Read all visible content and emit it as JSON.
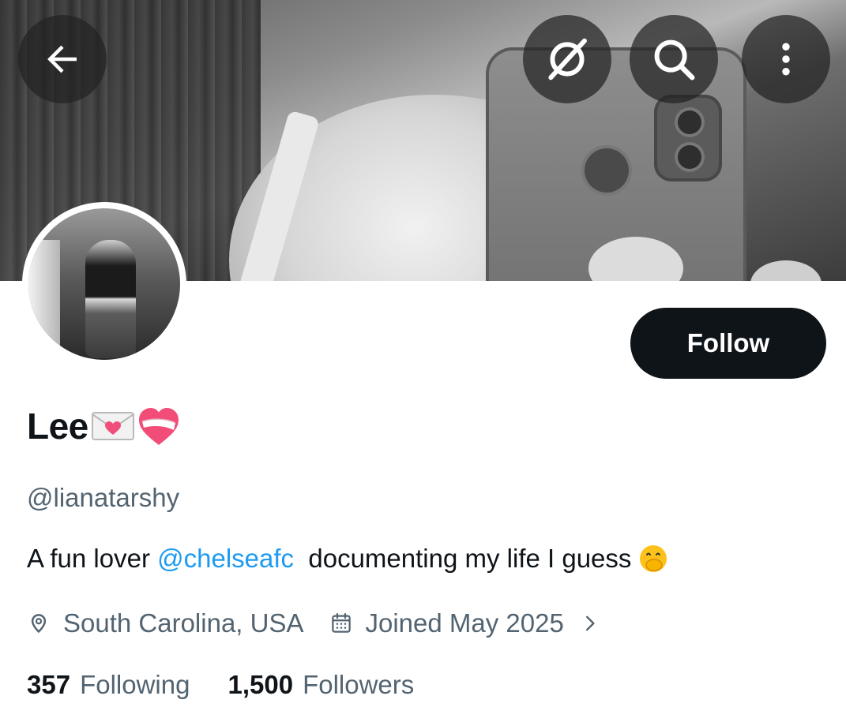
{
  "header": {
    "back_icon": "arrow-left-icon",
    "grok_icon": "grok-icon",
    "search_icon": "search-icon",
    "more_icon": "more-vertical-icon"
  },
  "profile": {
    "display_name": "Lee",
    "display_name_emojis": [
      "love-letter-emoji",
      "mending-heart-emoji"
    ],
    "handle": "@lianatarshy",
    "bio": {
      "prefix": "A fun lover ",
      "mention": "@chelseafc",
      "suffix": "  documenting my life I guess",
      "emoji": "face-with-hand-over-mouth-emoji"
    },
    "location": "South Carolina, USA",
    "joined": "Joined May 2025",
    "following_count": "357",
    "following_label": "Following",
    "followers_count": "1,500",
    "followers_label": "Followers"
  },
  "actions": {
    "follow_label": "Follow"
  },
  "colors": {
    "text_primary": "#0f1419",
    "text_secondary": "#536471",
    "accent": "#1d9bf0",
    "follow_bg": "#0f1419",
    "overlay_btn": "#222222"
  }
}
